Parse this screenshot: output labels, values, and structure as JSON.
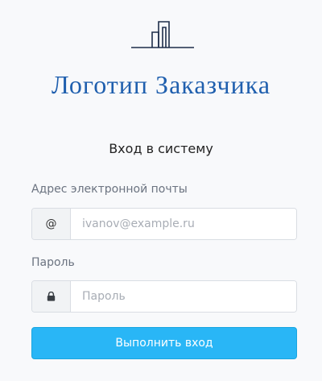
{
  "brand": {
    "logo_text": "Логотип Заказчика",
    "logo_icon": "building-skyline-icon"
  },
  "login": {
    "title": "Вход в систему",
    "email": {
      "label": "Адрес электронной почты",
      "addon": "@",
      "placeholder": "ivanov@example.ru",
      "value": ""
    },
    "password": {
      "label": "Пароль",
      "addon_icon": "lock-icon",
      "placeholder": "Пароль",
      "value": ""
    },
    "submit_label": "Выполнить вход"
  },
  "colors": {
    "brand": "#1f5fae",
    "primary_button": "#29b6f6",
    "background": "#f8f9fb"
  }
}
